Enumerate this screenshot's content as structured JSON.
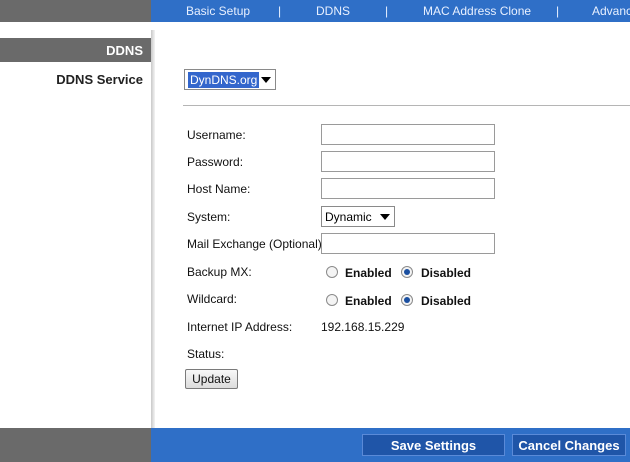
{
  "nav": {
    "items": [
      "Basic Setup",
      "DDNS",
      "MAC Address Clone",
      "Advanc"
    ],
    "separator": "|"
  },
  "sidebar": {
    "section_title": "DDNS",
    "field_label": "DDNS Service"
  },
  "ddns_service": {
    "selected": "DynDNS.org"
  },
  "form": {
    "username_label": "Username:",
    "password_label": "Password:",
    "hostname_label": "Host Name:",
    "system_label": "System:",
    "system_value": "Dynamic",
    "mx_label": "Mail Exchange (Optional):",
    "backup_mx_label": "Backup MX:",
    "wildcard_label": "Wildcard:",
    "enabled_label": "Enabled",
    "disabled_label": "Disabled",
    "ip_label": "Internet IP  Address:",
    "ip_value": "192.168.15.229",
    "status_label": "Status:",
    "update_label": "Update"
  },
  "footer": {
    "save_label": "Save Settings",
    "cancel_label": "Cancel Changes"
  },
  "colors": {
    "nav_blue": "#2f6fc7",
    "sidebar_gray": "#6a6a6a",
    "button_blue": "#1f55a8"
  }
}
